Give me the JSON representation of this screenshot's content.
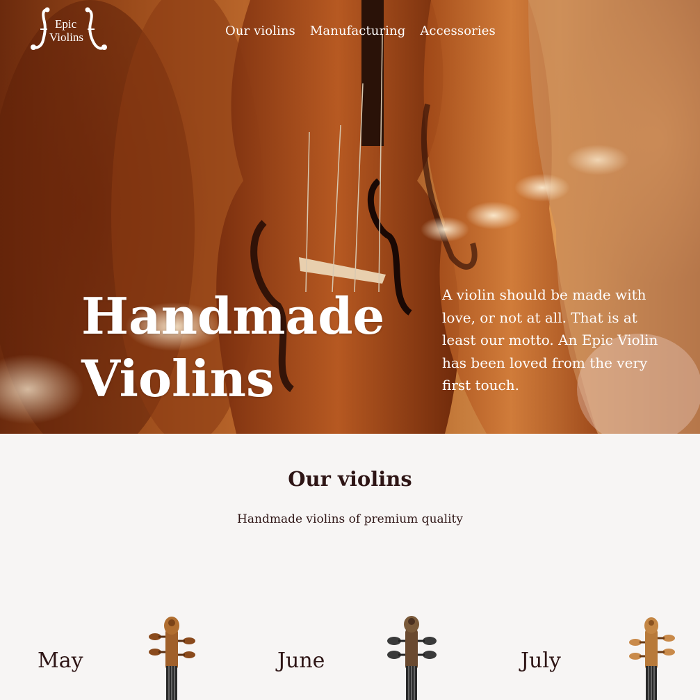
{
  "header": {
    "logo": {
      "line1": "Epic",
      "line2": "Violins"
    },
    "nav": [
      {
        "label": "Our violins"
      },
      {
        "label": "Manufacturing"
      },
      {
        "label": "Accessories"
      }
    ]
  },
  "hero": {
    "title_line1": "Handmade",
    "title_line2": "Violins",
    "text": "A violin should be made with love, or not at all. That is at least our motto. An Epic Violin has been loved from the very first touch."
  },
  "section": {
    "title": "Our violins",
    "subtitle": "Handmade violins of premium quality",
    "cards": [
      {
        "label": "May"
      },
      {
        "label": "June"
      },
      {
        "label": "July"
      }
    ]
  },
  "colors": {
    "background": "#f7f5f4",
    "text_dark": "#2e1515",
    "hero_text": "#ffffff"
  }
}
